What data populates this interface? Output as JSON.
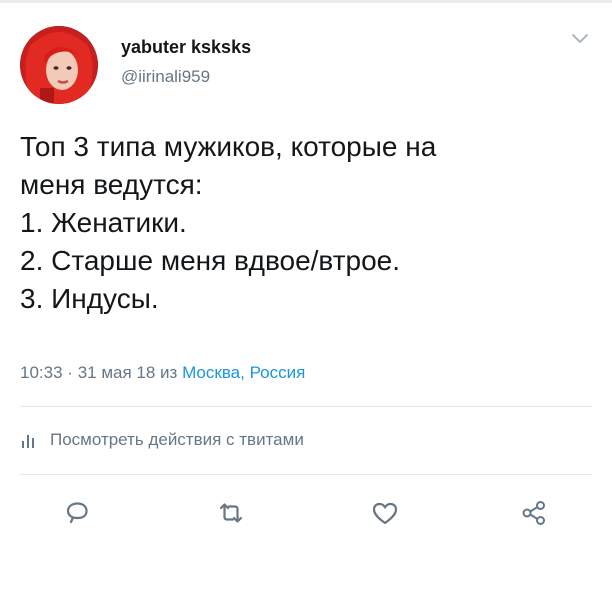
{
  "author": {
    "display_name": "yabuter ksksks",
    "handle": "@iirinali959"
  },
  "tweet": {
    "lines": [
      "Топ 3 типа мужиков, которые на",
      "меня ведутся:",
      "1. Женатики.",
      "2. Старше меня вдвое/втрое.",
      "3. Индусы."
    ]
  },
  "meta": {
    "time": "10:33",
    "separator": "·",
    "date": "31 мая 18",
    "from": "из",
    "city": "Москва",
    "comma": ",",
    "country": "Россия"
  },
  "activity": {
    "label": "Посмотреть действия с твитами",
    "icon": "bar-chart-icon"
  },
  "actions": [
    {
      "name": "reply",
      "icon": "reply-icon"
    },
    {
      "name": "retweet",
      "icon": "retweet-icon"
    },
    {
      "name": "like",
      "icon": "heart-icon"
    },
    {
      "name": "share",
      "icon": "share-icon"
    }
  ],
  "colors": {
    "text": "#14171a",
    "secondary": "#657786",
    "link": "#1b95e0",
    "divider": "#e1e8ed"
  }
}
